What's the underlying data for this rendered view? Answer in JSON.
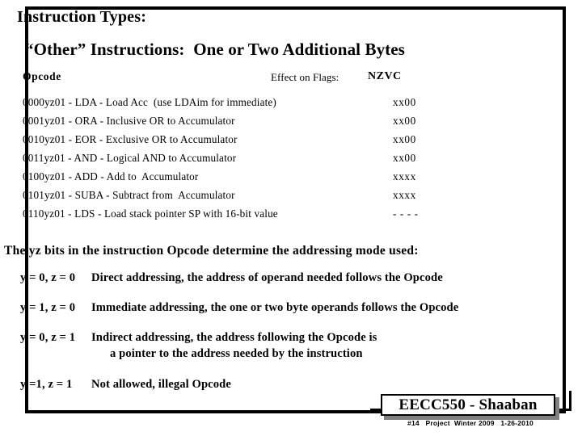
{
  "slide": {
    "title": "Instruction Types:",
    "subtitle": "“Other” Instructions:  One or Two Additional Bytes"
  },
  "table": {
    "header": {
      "opcode": "Opcode",
      "effect": "Effect on Flags:",
      "flags": "NZVC"
    },
    "rows": [
      {
        "text": "0000yz01 - LDA - Load Acc  (use LDAim for immediate)",
        "flags": "xx00"
      },
      {
        "text": "0001yz01 - ORA - Inclusive OR to Accumulator",
        "flags": "xx00"
      },
      {
        "text": "0010yz01 - EOR - Exclusive OR to Accumulator",
        "flags": "xx00"
      },
      {
        "text": "0011yz01 - AND - Logical AND to Accumulator",
        "flags": "xx00"
      },
      {
        "text": "0100yz01 - ADD - Add to  Accumulator",
        "flags": "xxxx"
      },
      {
        "text": "0101yz01 - SUBA - Subtract from  Accumulator",
        "flags": "xxxx"
      },
      {
        "text": "0110yz01 - LDS - Load stack pointer SP with 16-bit value",
        "flags": "- - - -"
      }
    ]
  },
  "addressing": {
    "intro": "The yz bits in the instruction Opcode determine the addressing mode used:",
    "modes": [
      {
        "label": "y = 0, z = 0",
        "desc": "Direct addressing, the address of operand needed follows the Opcode",
        "desc2": ""
      },
      {
        "label": "y = 1, z = 0",
        "desc": "Immediate addressing, the one or two byte operands follows the Opcode",
        "desc2": ""
      },
      {
        "label": "y = 0, z = 1",
        "desc": "Indirect addressing, the address following the Opcode is",
        "desc2": "a pointer to the address needed by the instruction"
      },
      {
        "label": "y =1, z = 1",
        "desc": "Not allowed, illegal Opcode",
        "desc2": ""
      }
    ]
  },
  "footer": {
    "badge": "EECC550 - Shaaban",
    "note": "#14   Project  Winter 2009   1-26-2010"
  },
  "colors": {
    "text": "#000000",
    "background": "#ffffff",
    "frame": "#000000",
    "shadow": "#808080"
  }
}
